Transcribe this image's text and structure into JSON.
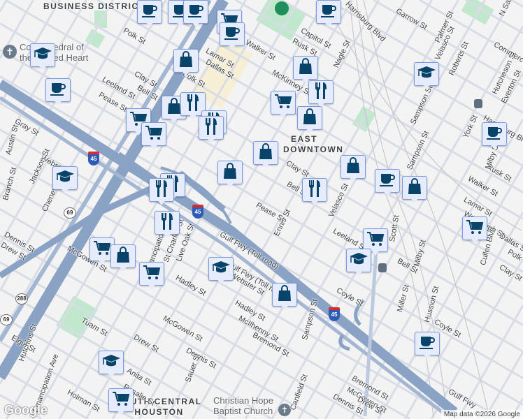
{
  "areas": {
    "cbd": "BUSINESS DISTRICT",
    "east_downtown": "EAST DOWNTOWN",
    "south_central": "SOUTH CENTRAL HOUSTON"
  },
  "pois": {
    "cathedral": "Co-Cathedral of the Sacred Heart",
    "church": "Christian Hope Baptist Church"
  },
  "streets": [
    "Polk St",
    "Clay St",
    "Bell St",
    "Leeland St",
    "Pease St",
    "Gray St",
    "Webster St",
    "Jackson St",
    "Chenevert St",
    "Branch St",
    "Austin St",
    "Dennis St",
    "Drew St",
    "McGowen St",
    "Emancipation Ave",
    "St Charles St",
    "Live Oak St",
    "Hadley St",
    "Gulf Fwy (Toll road)",
    "Gulf Fwy (Toll road)",
    "Webster St",
    "Hadley St",
    "McIlhenny St",
    "Bremond St",
    "McGowen St",
    "Tuam St",
    "Drew St",
    "Dennis St",
    "Sauer St",
    "Elgin St",
    "Hutchins St",
    "Anita St",
    "Rosalie St",
    "Emancipation Ave",
    "Holman St",
    "Sampson St",
    "Canfield St",
    "Ennis St",
    "Pease St",
    "Bell St",
    "Clay St",
    "Leeland St",
    "Velasco St",
    "Coyle St",
    "Miller St",
    "Hussion St",
    "Coyle St",
    "Scott St",
    "Milby St",
    "Bell St",
    "Clay St",
    "Polk St",
    "Dallas St",
    "Lamar St",
    "Woodleigh St",
    "Walker St",
    "Rusk St",
    "Cullen Blvd",
    "Milby St",
    "Harrisburg Blvd",
    "Everton St",
    "Hutcheson St",
    "York St",
    "Sampson St",
    "Sampson St",
    "Roberts St",
    "Velasco St",
    "Palmer St",
    "Garrow St",
    "Harrisburg Blvd",
    "Nagle St",
    "Rusk St",
    "Capitol St",
    "McKinney St",
    "Walker St",
    "Lamar St",
    "Dallas St",
    "Polk St",
    "Bremond St",
    "McGowen St",
    "Dennis St",
    "Drew St",
    "Gulf Fwy",
    "N San Jacinto",
    "Commerce St"
  ],
  "markers": [
    {
      "type": "coffee"
    },
    {
      "type": "coffee"
    },
    {
      "type": "coffee"
    },
    {
      "type": "cart"
    },
    {
      "type": "coffee"
    },
    {
      "type": "coffee"
    },
    {
      "type": "graduation"
    },
    {
      "type": "bag"
    },
    {
      "type": "coffee"
    },
    {
      "type": "graduation"
    },
    {
      "type": "bag"
    },
    {
      "type": "fork-knife"
    },
    {
      "type": "cart"
    },
    {
      "type": "bag"
    },
    {
      "type": "cart"
    },
    {
      "type": "bag"
    },
    {
      "type": "fork-knife"
    },
    {
      "type": "fork-knife"
    },
    {
      "type": "fork-knife"
    },
    {
      "type": "cart"
    },
    {
      "type": "bag"
    },
    {
      "type": "bag"
    },
    {
      "type": "bag"
    },
    {
      "type": "coffee"
    },
    {
      "type": "bag"
    },
    {
      "type": "fork-knife"
    },
    {
      "type": "graduation"
    },
    {
      "type": "fork-knife"
    },
    {
      "type": "fork-knife"
    },
    {
      "type": "fork-knife"
    },
    {
      "type": "coffee"
    },
    {
      "type": "cart"
    },
    {
      "type": "cart"
    },
    {
      "type": "graduation"
    },
    {
      "type": "cart"
    },
    {
      "type": "bag"
    },
    {
      "type": "cart"
    },
    {
      "type": "graduation"
    },
    {
      "type": "bag"
    },
    {
      "type": "coffee"
    },
    {
      "type": "graduation"
    },
    {
      "type": "cart"
    }
  ],
  "shields": [
    "45",
    "45",
    "45",
    "69",
    "288",
    "69"
  ],
  "footer": {
    "attribution": "Map data ©2026 Google",
    "logo": "Google"
  },
  "colors": {
    "marker_fill": "#e6ecfb",
    "marker_border": "#7b9be0",
    "icon": "#08446a",
    "freeway": "#8aa2c4",
    "park": "#c8ecd3"
  }
}
